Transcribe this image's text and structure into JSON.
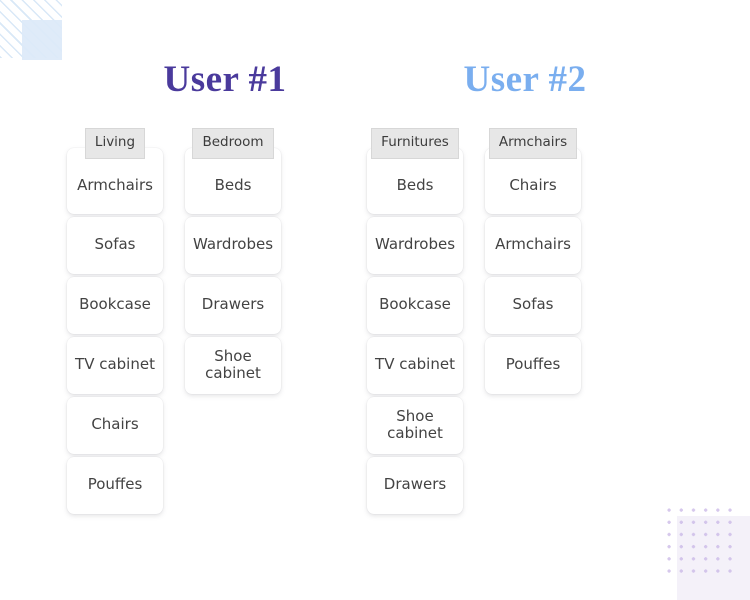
{
  "decorations": {
    "stripes_top_left": "diagonal-stripes-icon",
    "square_top_left_color": "#dce9f9",
    "dots_bottom_right": "dot-grid-icon",
    "square_bottom_right_color": "#f4f1f9",
    "dot_color": "#c8b6e6"
  },
  "users": [
    {
      "title": "User #1",
      "title_color": "#4a3a9c",
      "columns": [
        {
          "category": "Living",
          "items": [
            "Armchairs",
            "Sofas",
            "Bookcase",
            "TV cabinet",
            "Chairs",
            "Pouffes"
          ]
        },
        {
          "category": "Bedroom",
          "items": [
            "Beds",
            "Wardrobes",
            "Drawers",
            "Shoe\ncabinet"
          ]
        }
      ]
    },
    {
      "title": "User #2",
      "title_color": "#7aaeef",
      "columns": [
        {
          "category": "Furnitures",
          "items": [
            "Beds",
            "Wardrobes",
            "Bookcase",
            "TV cabinet",
            "Shoe\ncabinet",
            "Drawers"
          ]
        },
        {
          "category": "Armchairs",
          "items": [
            "Chairs",
            "Armchairs",
            "Sofas",
            "Pouffes"
          ]
        }
      ]
    }
  ]
}
